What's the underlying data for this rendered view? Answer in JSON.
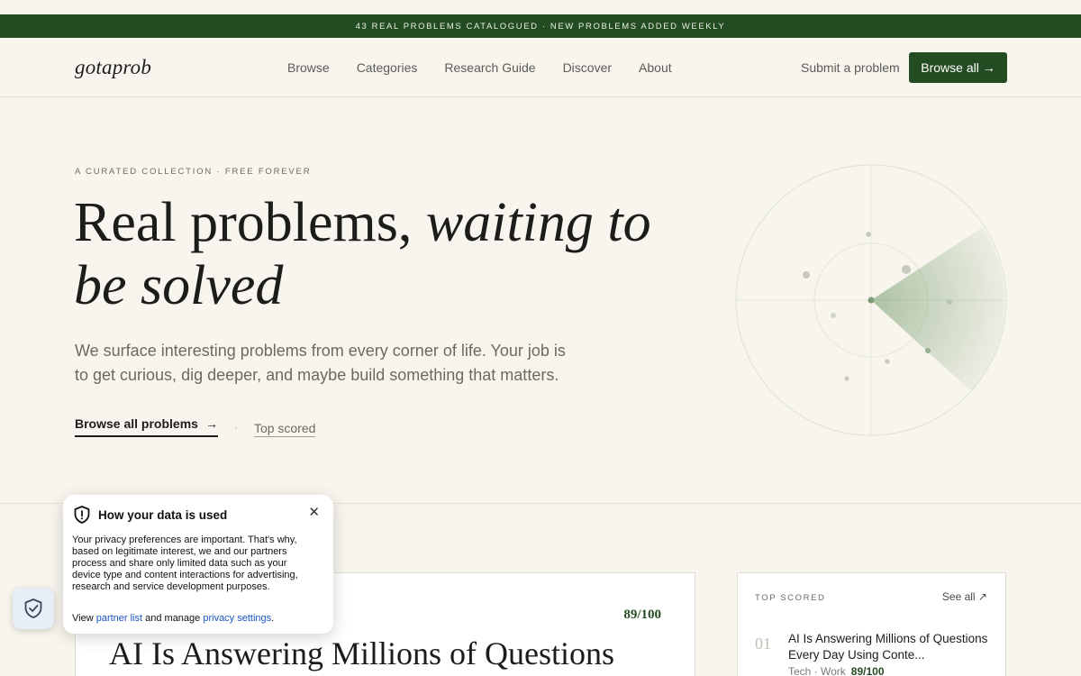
{
  "announcement": "43 REAL PROBLEMS CATALOGUED · NEW PROBLEMS ADDED WEEKLY",
  "header": {
    "logo": "gotaprob",
    "nav": [
      "Browse",
      "Categories",
      "Research Guide",
      "Discover",
      "About"
    ],
    "submit_label": "Submit a problem",
    "browse_all_label": "Browse all →"
  },
  "hero": {
    "kicker": "A CURATED COLLECTION · FREE FOREVER",
    "title_plain": "Real problems, ",
    "title_italic": "waiting to be solved",
    "subtitle": "We surface interesting problems from every corner of life. Your job is to get curious, dig deeper, and maybe build something that matters.",
    "cta_primary": "Browse all problems",
    "cta_arrow": "→",
    "cta_separator": "·",
    "cta_secondary": "Top scored"
  },
  "featured": {
    "score": "89/100",
    "title": "AI Is Answering Millions of Questions"
  },
  "top_scored": {
    "label": "TOP SCORED",
    "see_all": "See all ↗",
    "items": [
      {
        "rank": "01",
        "title": "AI Is Answering Millions of Questions Every Day Using Conte...",
        "meta": "Tech · Work",
        "score": "89/100"
      }
    ]
  },
  "privacy": {
    "title": "How your data is used",
    "close": "✕",
    "body": "Your privacy preferences are important. That's why, based on legitimate interest, we and our partners process and share only limited data such as your device type and content interactions for advertising, research and service development purposes.",
    "foot_prefix": "View ",
    "partner_link": "partner list",
    "foot_middle": " and manage ",
    "settings_link": "privacy settings",
    "foot_suffix": "."
  },
  "colors": {
    "brand_green": "#244c22",
    "background": "#f8f5ee",
    "link_blue": "#1a56c4"
  },
  "icons": {
    "privacy_popup": "shield-icon",
    "privacy_fab": "shield-check-icon",
    "cta": "arrow-right-icon"
  }
}
